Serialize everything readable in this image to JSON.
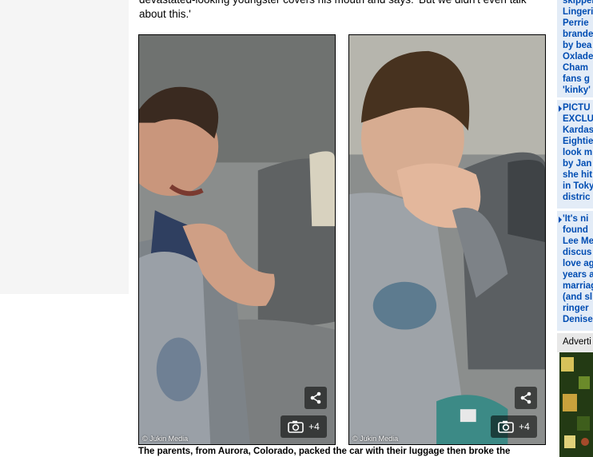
{
  "article": {
    "text_line_1": "devastated-looking youngster covers his mouth and says: 'But we didn't even talk",
    "text_line_2": "about this.'",
    "caption": "The parents, from Aurora, Colorado, packed the car with their luggage then broke the"
  },
  "photos": [
    {
      "credit": "© Jukin Media",
      "gallery_count": "+4",
      "share_icon": "share-icon",
      "camera_icon": "camera-icon"
    },
    {
      "credit": "© Jukin Media",
      "gallery_count": "+4",
      "share_icon": "share-icon",
      "camera_icon": "camera-icon"
    }
  ],
  "sidebar": {
    "items": [
      {
        "text": "skipper\nLingeri\nPerrie\nbrande\nby bea\nOxlade\nCham\nfans g\n'kinky'"
      },
      {
        "text": "PICTU\nEXCLU\nKardas\nEightie\nlook m\nby Jan\nshe hit\nin Toky\ndistric"
      },
      {
        "text": "'It's ni\nfound\nLee Me\ndiscus\nlove ag\nyears a\nmarriag\n(and sl\nringer\nDenise"
      }
    ],
    "advert_label": "Adverti"
  },
  "colors": {
    "link_blue": "#004db3",
    "sidebar_bg": "#e3ecf7",
    "overlay": "rgba(0,0,0,0.55)"
  }
}
